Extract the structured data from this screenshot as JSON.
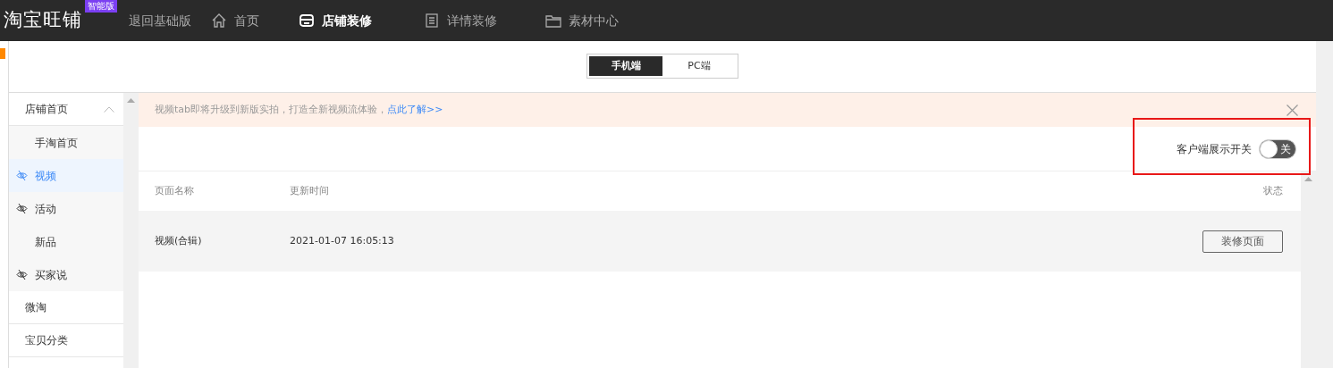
{
  "header": {
    "logo": "淘宝旺铺",
    "edition_badge": "智能版",
    "back_link": "退回基础版",
    "nav": [
      {
        "label": "首页",
        "kind": "home",
        "selected": false
      },
      {
        "label": "店铺装修",
        "kind": "store",
        "selected": true
      },
      {
        "label": "详情装修",
        "kind": "document",
        "selected": false
      },
      {
        "label": "素材中心",
        "kind": "folder",
        "selected": false
      }
    ]
  },
  "device_tabs": [
    {
      "label": "手机端",
      "selected": true
    },
    {
      "label": "PC端",
      "selected": false
    }
  ],
  "sidebar": {
    "items": [
      {
        "label": "店铺首页",
        "expanded": true,
        "children": [
          {
            "label": "手淘首页",
            "hidden": false,
            "selected": false
          },
          {
            "label": "视频",
            "hidden": true,
            "selected": true
          },
          {
            "label": "活动",
            "hidden": true,
            "selected": false
          },
          {
            "label": "新品",
            "hidden": false,
            "selected": false
          },
          {
            "label": "买家说",
            "hidden": true,
            "selected": false
          }
        ]
      },
      {
        "label": "微淘"
      },
      {
        "label": "宝贝分类"
      }
    ]
  },
  "notice": {
    "text": "视频tab即将升级到新版实拍，打造全新视频流体验，",
    "link": "点此了解>>"
  },
  "display_switch": {
    "label": "客户端展示开关",
    "on": false,
    "state_text": "关"
  },
  "table": {
    "columns": [
      "页面名称",
      "更新时间",
      "状态"
    ],
    "rows": [
      {
        "name": "视频(合辑)",
        "updated": "2021-01-07 16:05:13",
        "action": "装修页面"
      }
    ]
  }
}
